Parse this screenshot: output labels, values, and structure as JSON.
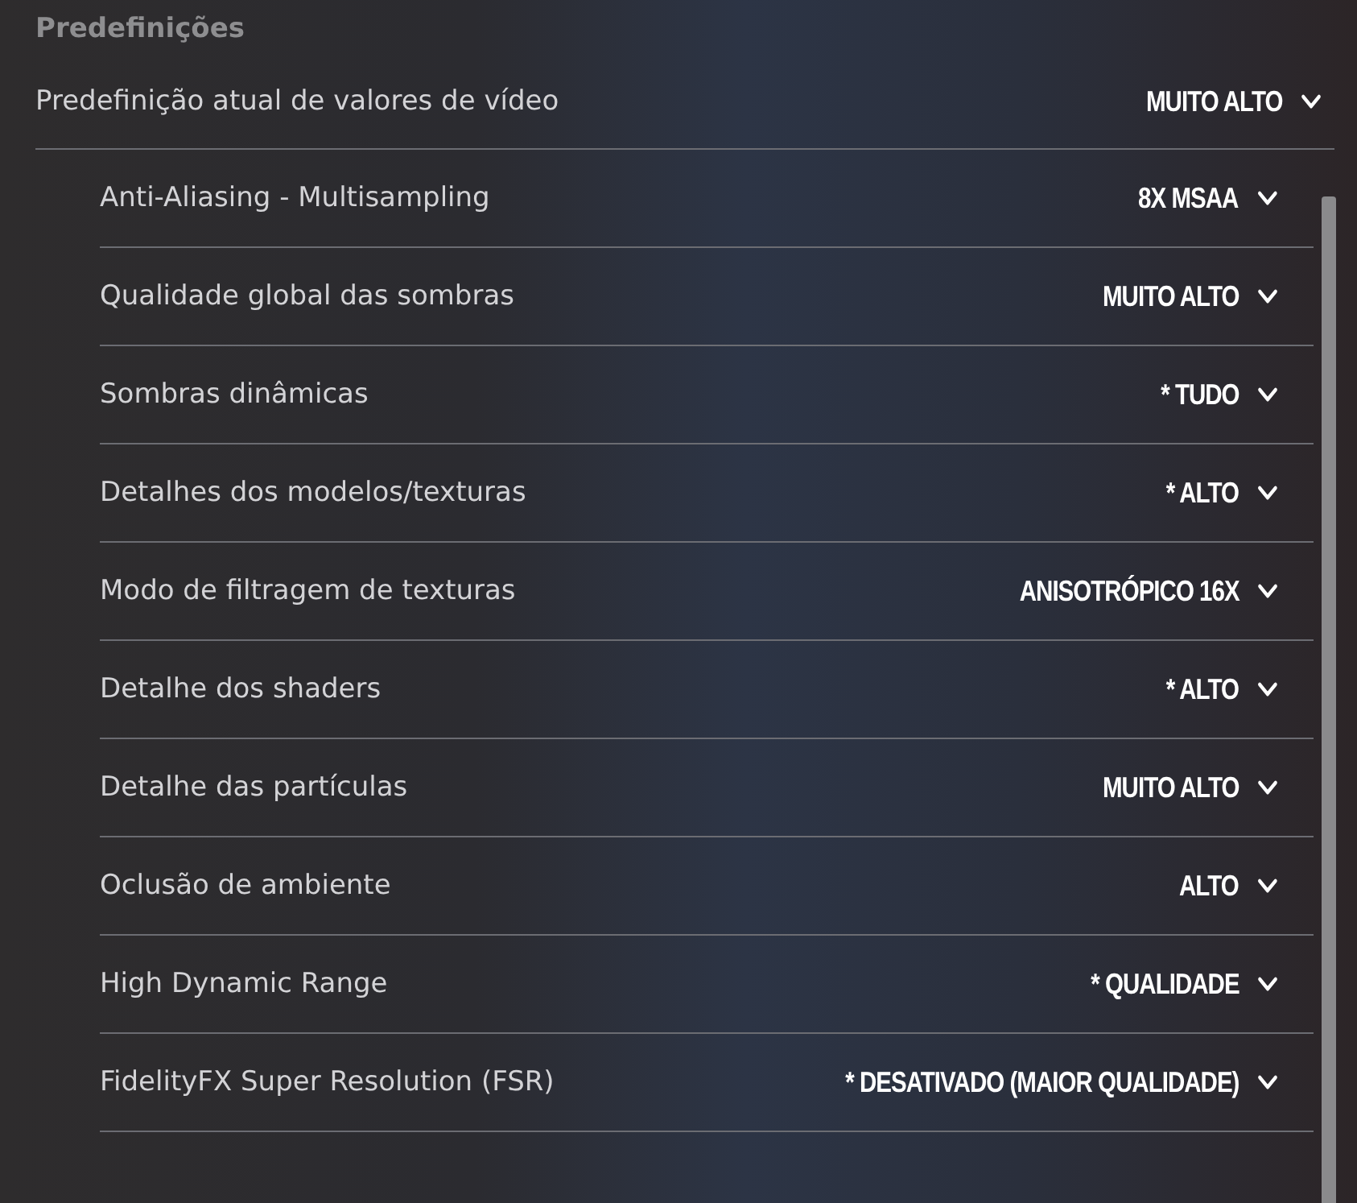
{
  "section_title": "Predefinições",
  "preset": {
    "label": "Predefinição atual de valores de vídeo",
    "value": "MUITO ALTO"
  },
  "settings": [
    {
      "label": "Anti-Aliasing - Multisampling",
      "value": "8X MSAA"
    },
    {
      "label": "Qualidade global das sombras",
      "value": "MUITO ALTO"
    },
    {
      "label": "Sombras dinâmicas",
      "value": "* TUDO"
    },
    {
      "label": "Detalhes dos modelos/texturas",
      "value": "* ALTO"
    },
    {
      "label": "Modo de filtragem de texturas",
      "value": "ANISOTRÓPICO 16X"
    },
    {
      "label": "Detalhe dos shaders",
      "value": "* ALTO"
    },
    {
      "label": "Detalhe das partículas",
      "value": "MUITO ALTO"
    },
    {
      "label": "Oclusão de ambiente",
      "value": "ALTO"
    },
    {
      "label": "High Dynamic Range",
      "value": "* QUALIDADE"
    },
    {
      "label": "FidelityFX Super Resolution (FSR)",
      "value": "* DESATIVADO (MAIOR QUALIDADE)"
    }
  ]
}
